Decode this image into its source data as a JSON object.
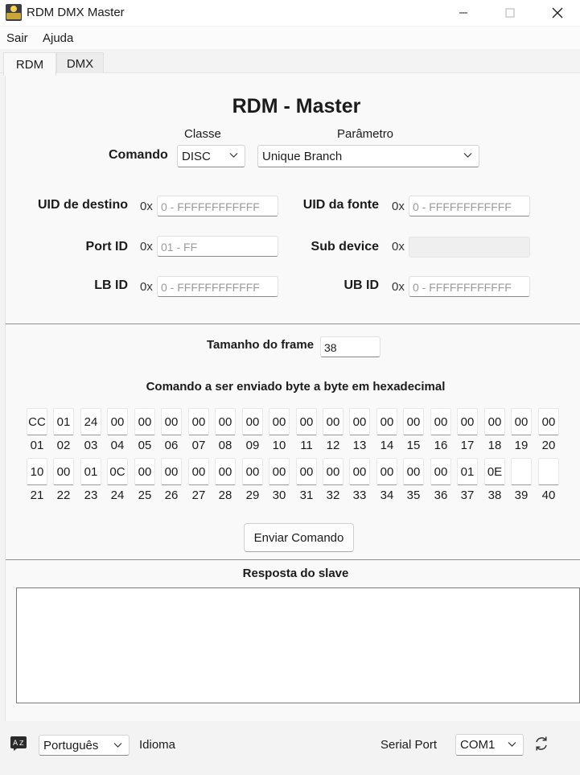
{
  "window": {
    "title": "RDM DMX Master",
    "icon": "app-icon",
    "controls": [
      "minimize-icon",
      "maximize-icon",
      "close-icon"
    ]
  },
  "menu": {
    "items": [
      "Sair",
      "Ajuda"
    ]
  },
  "tabs": [
    {
      "label": "RDM",
      "active": true
    },
    {
      "label": "DMX",
      "active": false
    }
  ],
  "rdm": {
    "heading": "RDM - Master",
    "command": {
      "label": "Comando",
      "class_header": "Classe",
      "param_header": "Parâmetro",
      "class_value": "DISC",
      "param_value": "Unique Branch"
    },
    "fields": {
      "dest_uid": {
        "label": "UID de destino",
        "prefix": "0x",
        "placeholder": "0 - FFFFFFFFFFFF"
      },
      "source_uid": {
        "label": "UID da fonte",
        "prefix": "0x",
        "placeholder": "0 - FFFFFFFFFFFF"
      },
      "port_id": {
        "label": "Port ID",
        "prefix": "0x",
        "placeholder": "01 - FF"
      },
      "sub_device": {
        "label": "Sub device",
        "prefix": "0x",
        "value": ""
      },
      "lb_id": {
        "label": "LB ID",
        "prefix": "0x",
        "placeholder": "0 - FFFFFFFFFFFF"
      },
      "ub_id": {
        "label": "UB ID",
        "prefix": "0x",
        "placeholder": "0 - FFFFFFFFFFFF"
      }
    },
    "frame": {
      "label": "Tamanho do frame",
      "value": "38"
    },
    "bytes_heading": "Comando a ser enviado byte a byte em hexadecimal",
    "bytes_row1": [
      "CC",
      "01",
      "24",
      "00",
      "00",
      "00",
      "00",
      "00",
      "00",
      "00",
      "00",
      "00",
      "00",
      "00",
      "00",
      "00",
      "00",
      "00",
      "00",
      "00"
    ],
    "indices_row1": [
      "01",
      "02",
      "03",
      "04",
      "05",
      "06",
      "07",
      "08",
      "09",
      "10",
      "11",
      "12",
      "13",
      "14",
      "15",
      "16",
      "17",
      "18",
      "19",
      "20"
    ],
    "bytes_row2": [
      "10",
      "00",
      "01",
      "0C",
      "00",
      "00",
      "00",
      "00",
      "00",
      "00",
      "00",
      "00",
      "00",
      "00",
      "00",
      "00",
      "01",
      "0E",
      "",
      ""
    ],
    "indices_row2": [
      "21",
      "22",
      "23",
      "24",
      "25",
      "26",
      "27",
      "28",
      "29",
      "30",
      "31",
      "32",
      "33",
      "34",
      "35",
      "36",
      "37",
      "38",
      "39",
      "40"
    ],
    "send_button": "Enviar Comando",
    "response_heading": "Resposta do slave",
    "response_text": ""
  },
  "footer": {
    "language_icon": "translate-icon",
    "language_value": "Português",
    "language_label": "Idioma",
    "serial_label": "Serial Port",
    "serial_value": "COM1",
    "refresh_icon": "refresh-icon"
  }
}
